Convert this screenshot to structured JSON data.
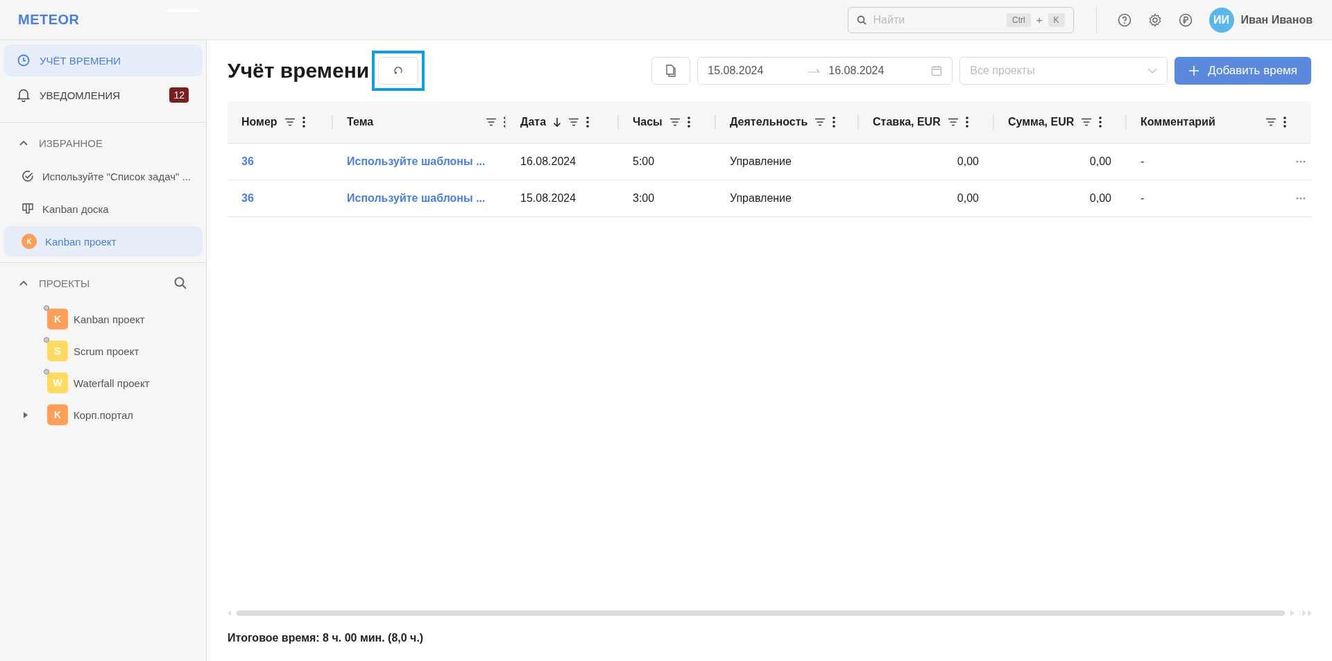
{
  "header": {
    "logo": "METEOR",
    "search": {
      "placeholder": "Найти",
      "keys": [
        "Ctrl",
        "+",
        "K"
      ]
    },
    "user": {
      "initials": "ИИ",
      "name": "Иван Иванов"
    }
  },
  "sidebar": {
    "nav": [
      {
        "label": "УЧЁТ ВРЕМЕНИ",
        "selected": true
      },
      {
        "label": "УВЕДОМЛЕНИЯ",
        "selected": false,
        "badge": "12"
      }
    ],
    "favorites": {
      "title": "ИЗБРАННОЕ",
      "expanded": true,
      "items": [
        {
          "kind": "task",
          "label": "Используйте \"Список задач\" ...",
          "selected": false
        },
        {
          "kind": "board",
          "label": "Kanban доска",
          "selected": false
        },
        {
          "kind": "project",
          "letter": "K",
          "color": "#ff9f5a",
          "label": "Kanban проект",
          "selected": true
        }
      ]
    },
    "projects": {
      "title": "ПРОЕКТЫ",
      "expanded": true,
      "items": [
        {
          "letter": "K",
          "color": "#ff9f5a",
          "label": "Kanban проект",
          "dot": true,
          "has_children": false
        },
        {
          "letter": "S",
          "color": "#ffdb63",
          "label": "Scrum проект",
          "dot": true,
          "has_children": false
        },
        {
          "letter": "W",
          "color": "#ffdb63",
          "label": "Waterfall проект",
          "dot": true,
          "has_children": false
        },
        {
          "letter": "K",
          "color": "#ff9f5a",
          "label": "Корп.портал",
          "dot": false,
          "has_children": true
        }
      ]
    }
  },
  "page": {
    "title": "Учёт времени",
    "highlighted_refresh": true,
    "date_from": "15.08.2024",
    "date_to": "16.08.2024",
    "project_placeholder": "Все проекты",
    "add_button": "Добавить время"
  },
  "table": {
    "columns": [
      {
        "label": "Номер",
        "kind": "link",
        "sorted_desc": false
      },
      {
        "label": "Тема",
        "kind": "link",
        "sorted_desc": false
      },
      {
        "label": "Дата",
        "kind": "text",
        "sorted_desc": true
      },
      {
        "label": "Часы",
        "kind": "text",
        "sorted_desc": false
      },
      {
        "label": "Деятельность",
        "kind": "text",
        "sorted_desc": false
      },
      {
        "label": "Ставка, EUR",
        "kind": "number",
        "sorted_desc": false
      },
      {
        "label": "Сумма, EUR",
        "kind": "number",
        "sorted_desc": false
      },
      {
        "label": "Комментарий",
        "kind": "text",
        "sorted_desc": false
      }
    ],
    "rows": [
      [
        "36",
        "Используйте шаблоны ...",
        "16.08.2024",
        "5:00",
        "Управление",
        "0,00",
        "0,00",
        "-"
      ],
      [
        "36",
        "Используйте шаблоны ...",
        "15.08.2024",
        "3:00",
        "Управление",
        "0,00",
        "0,00",
        "-"
      ]
    ]
  },
  "total": "Итоговое время: 8 ч. 00 мин. (8,0 ч.)"
}
